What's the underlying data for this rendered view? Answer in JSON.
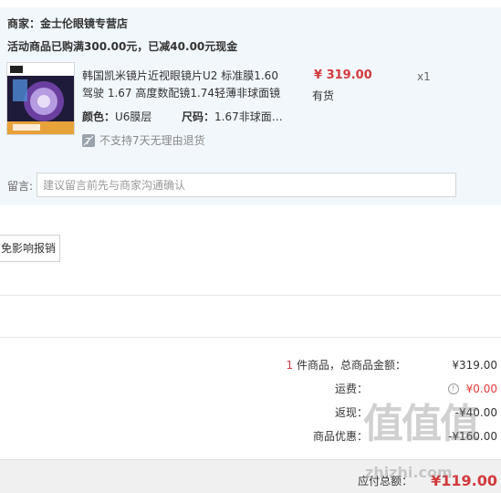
{
  "store": {
    "label": "商家：",
    "name": "金士伦眼镜专营店"
  },
  "promotion": "活动商品已购满300.00元，已减40.00元现金",
  "product": {
    "title_line1": "韩国凯米镜片近视眼镜片U2 标准膜1.60",
    "title_line2": "驾驶 1.67 高度数配镜1.74轻薄非球面镜",
    "price": "¥ 319.00",
    "stock": "有货",
    "quantity": "x1",
    "color_label": "颜色：",
    "color_value": "U6膜层",
    "size_label": "尺码：",
    "size_value": "1.67非球面…",
    "return_policy": "不支持7天无理由退货"
  },
  "remark": {
    "label": "留言:",
    "placeholder": "建议留言前先与商家沟通确认"
  },
  "receipt_button": "免影响报销",
  "summary": {
    "count": "1",
    "count_suffix": "件商品，总商品金额：",
    "total": "¥319.00",
    "shipping_label": "运费：",
    "shipping_value": "¥0.00",
    "cashback_label": "返现：",
    "cashback_value": "-¥40.00",
    "discount_label": "商品优惠：",
    "discount_value": "-¥160.00",
    "payable_label": "应付总额：",
    "payable_value": "¥119.00"
  },
  "watermark": {
    "chars": "值值值",
    "url": "zhizhi.com"
  },
  "colors": {
    "price_red": "#d23b3e",
    "shipping_orange": "#e4393c",
    "block_bg": "#f2f7fc"
  }
}
